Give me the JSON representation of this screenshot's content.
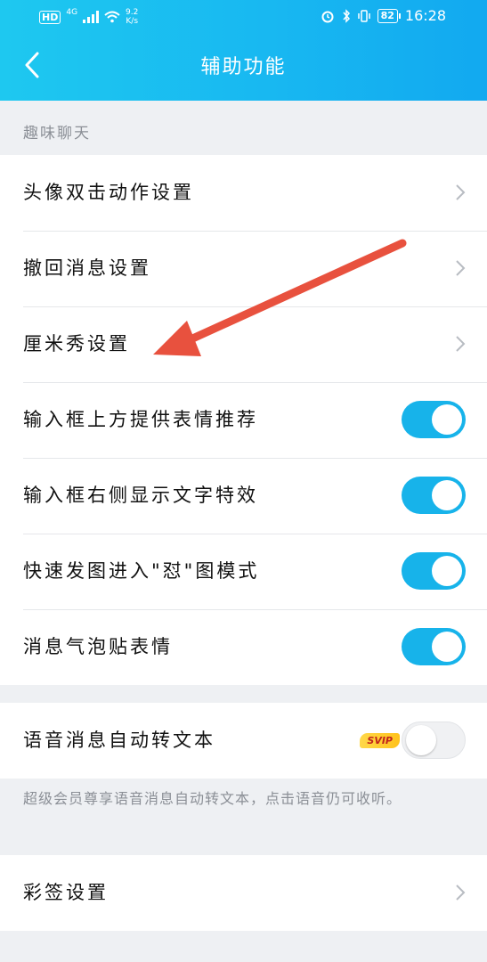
{
  "status_bar": {
    "hd": "HD",
    "network": "4G",
    "speed_value": "9.2",
    "speed_unit": "K/s",
    "battery": "82",
    "time": "16:28"
  },
  "header": {
    "title": "辅助功能",
    "back_icon": "chevron-left-icon"
  },
  "section_label": "趣味聊天",
  "group1": [
    {
      "label": "头像双击动作设置",
      "control": "chevron"
    },
    {
      "label": "撤回消息设置",
      "control": "chevron"
    },
    {
      "label": "厘米秀设置",
      "control": "chevron"
    },
    {
      "label": "输入框上方提供表情推荐",
      "control": "toggle",
      "on": true
    },
    {
      "label": "输入框右侧显示文字特效",
      "control": "toggle",
      "on": true
    },
    {
      "label": "快速发图进入\"怼\"图模式",
      "control": "toggle",
      "on": true
    },
    {
      "label": "消息气泡贴表情",
      "control": "toggle",
      "on": true
    }
  ],
  "voice": {
    "label": "语音消息自动转文本",
    "badge": "SVIP",
    "on": false,
    "note": "超级会员尊享语音消息自动转文本，点击语音仍可收听。"
  },
  "caisign": {
    "label": "彩签设置"
  },
  "colors": {
    "accent": "#17b3ea",
    "header": "#18b8f1",
    "annotation_arrow": "#e8513e"
  }
}
